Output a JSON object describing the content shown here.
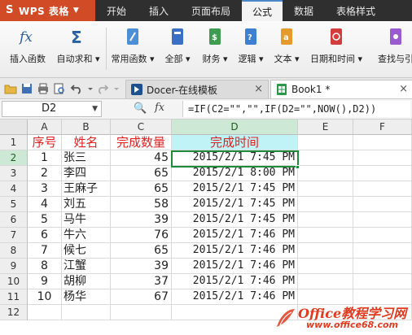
{
  "app": {
    "title": "WPS 表格",
    "menu_caret": "▼"
  },
  "ribbon_tabs": [
    "开始",
    "插入",
    "页面布局",
    "公式",
    "数据",
    "表格样式"
  ],
  "ribbon_active_tab": "公式",
  "ribbon_buttons": [
    {
      "label": "插入函数",
      "icon": "fx-icon"
    },
    {
      "label": "自动求和 ▾",
      "icon": "sigma-icon"
    },
    {
      "label": "常用函数 ▾",
      "icon": "common-functions-icon"
    },
    {
      "label": "全部 ▾",
      "icon": "all-functions-icon"
    },
    {
      "label": "财务 ▾",
      "icon": "finance-icon"
    },
    {
      "label": "逻辑 ▾",
      "icon": "logic-icon"
    },
    {
      "label": "文本 ▾",
      "icon": "text-icon"
    },
    {
      "label": "日期和时间 ▾",
      "icon": "datetime-icon"
    },
    {
      "label": "查找与引",
      "icon": "lookup-icon"
    }
  ],
  "doc_tabs": [
    {
      "label": "Docer-在线模板",
      "close": "×",
      "active": false
    },
    {
      "label": "Book1 *",
      "close": "×",
      "active": true
    }
  ],
  "formula_bar": {
    "name_box": "D2",
    "name_caret": "▼",
    "zoom_symbol": "🔍",
    "fx_symbol": "fx",
    "formula": "=IF(C2=\"\",\"\",IF(D2=\"\",NOW(),D2))"
  },
  "grid": {
    "columns": [
      "A",
      "B",
      "C",
      "D",
      "E",
      "F"
    ],
    "selected_column": "D",
    "selected_row": 2,
    "header_row": {
      "a": "序号",
      "b": "姓名",
      "c": "完成数量",
      "d": "完成时间"
    },
    "rows": [
      {
        "row": "1"
      },
      {
        "row": "2",
        "a": "1",
        "b": "张三",
        "c": "45",
        "d": "2015/2/1  7:45 PM"
      },
      {
        "row": "3",
        "a": "2",
        "b": "李四",
        "c": "65",
        "d": "2015/2/1  8:00 PM"
      },
      {
        "row": "4",
        "a": "3",
        "b": "王麻子",
        "c": "65",
        "d": "2015/2/1  7:45 PM"
      },
      {
        "row": "5",
        "a": "4",
        "b": "刘五",
        "c": "58",
        "d": "2015/2/1  7:45 PM"
      },
      {
        "row": "6",
        "a": "5",
        "b": "马牛",
        "c": "39",
        "d": "2015/2/1  7:45 PM"
      },
      {
        "row": "7",
        "a": "6",
        "b": "牛六",
        "c": "76",
        "d": "2015/2/1  7:46 PM"
      },
      {
        "row": "8",
        "a": "7",
        "b": "候七",
        "c": "65",
        "d": "2015/2/1  7:46 PM"
      },
      {
        "row": "9",
        "a": "8",
        "b": "江蟹",
        "c": "39",
        "d": "2015/2/1  7:46 PM"
      },
      {
        "row": "10",
        "a": "9",
        "b": "胡柳",
        "c": "37",
        "d": "2015/2/1  7:46 PM"
      },
      {
        "row": "11",
        "a": "10",
        "b": "杨华",
        "c": "67",
        "d": "2015/2/1  7:46 PM"
      },
      {
        "row": "12"
      }
    ]
  },
  "watermark": {
    "main": "Office教程学习网",
    "sub": "www.office68.com"
  },
  "colors": {
    "accent": "#d24b27",
    "header_text": "#e02020",
    "selection": "#1e8b3a",
    "d_header_bg": "#bff3f6"
  }
}
